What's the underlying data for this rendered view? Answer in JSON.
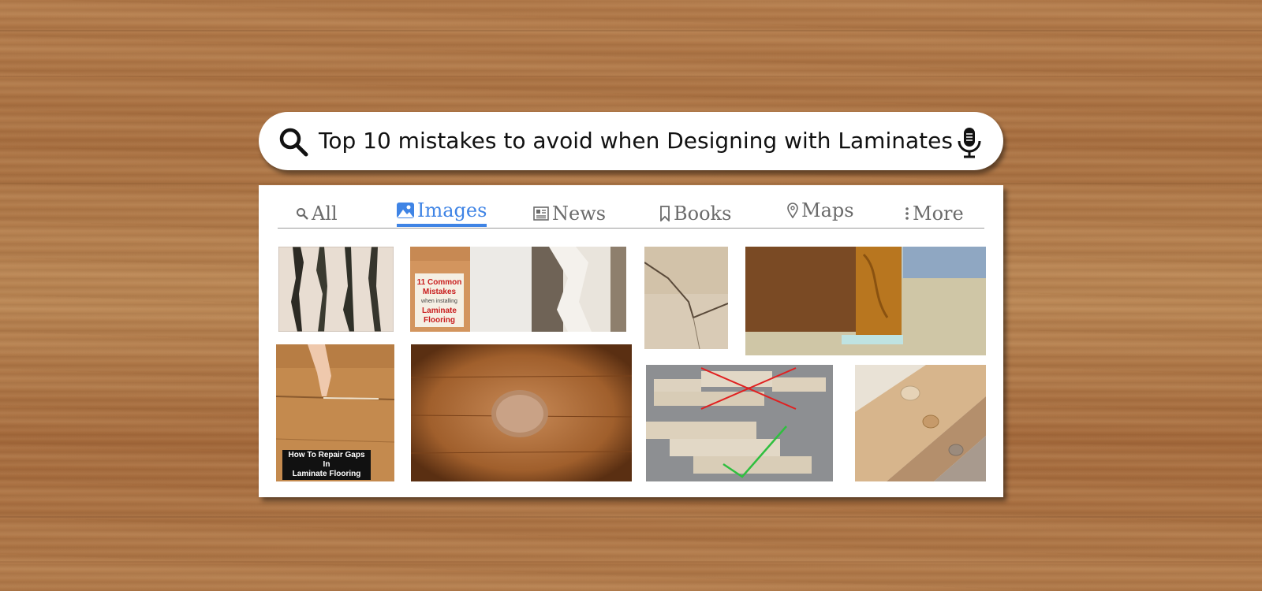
{
  "search": {
    "query": "Top 10 mistakes to avoid when Designing with Laminates"
  },
  "tabs": [
    {
      "label": "All",
      "icon": "search-icon",
      "active": false
    },
    {
      "label": "Images",
      "icon": "image-icon",
      "active": true
    },
    {
      "label": "News",
      "icon": "newspaper-icon",
      "active": false
    },
    {
      "label": "Books",
      "icon": "bookmark-icon",
      "active": false
    },
    {
      "label": "Maps",
      "icon": "map-pin-icon",
      "active": false
    },
    {
      "label": "More",
      "icon": "more-vertical-icon",
      "active": false
    }
  ],
  "results": {
    "r2_text": {
      "line1": "11 Common",
      "line2": "Mistakes",
      "line3": "when installing",
      "line4": "Laminate",
      "line5": "Flooring"
    },
    "r5_caption": {
      "line1": "How To Repair Gaps In",
      "line2": "Laminate Flooring"
    }
  },
  "colors": {
    "active_tab": "#3f84e5",
    "inactive_tab": "#6b6b6b",
    "background_wood": "#b27a4a"
  }
}
